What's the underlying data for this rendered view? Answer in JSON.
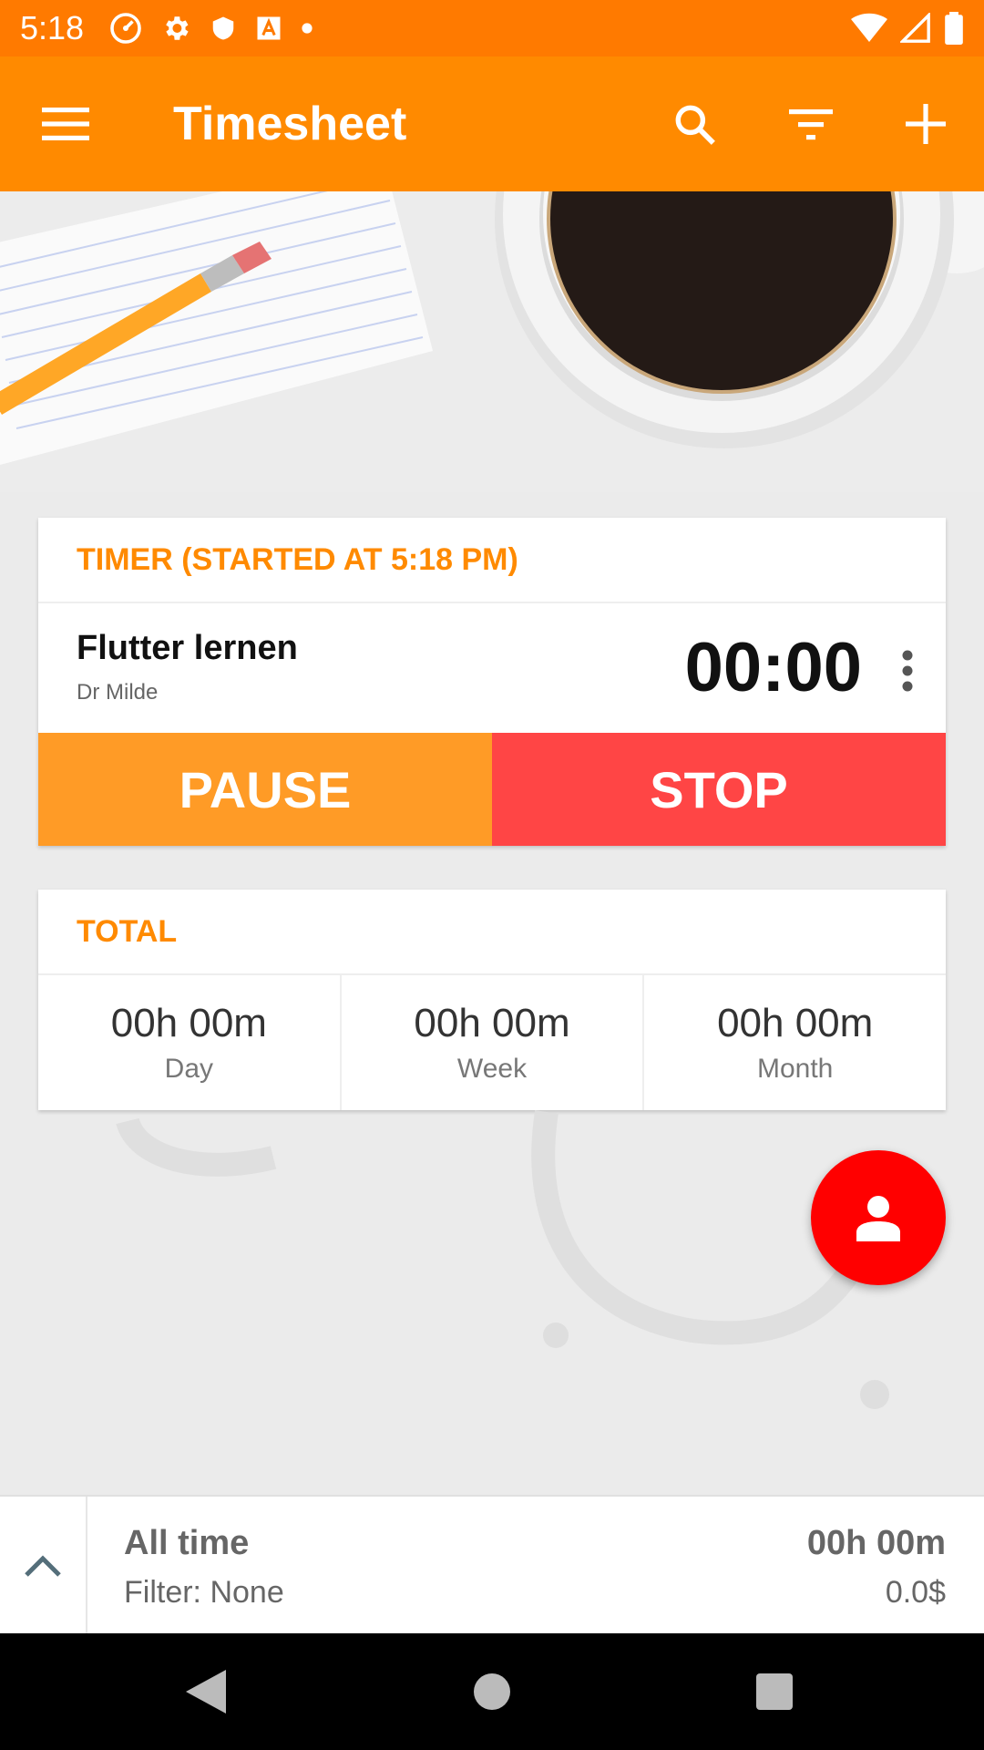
{
  "status_bar": {
    "time": "5:18",
    "left_icons": [
      "speedometer-icon",
      "gear-icon",
      "shield-icon",
      "font-icon",
      "dot-icon"
    ],
    "right_icons": [
      "wifi-icon",
      "cell-signal-icon",
      "battery-icon"
    ]
  },
  "app_bar": {
    "title": "Timesheet",
    "menu_icon": "menu-icon",
    "actions": [
      "search-icon",
      "filter-icon",
      "add-icon"
    ]
  },
  "timer_card": {
    "header": "TIMER (STARTED AT 5:18 PM)",
    "task_name": "Flutter lernen",
    "client": "Dr Milde",
    "elapsed": "00:00",
    "pause_label": "PAUSE",
    "stop_label": "STOP"
  },
  "totals_card": {
    "header": "TOTAL",
    "cells": [
      {
        "value": "00h 00m",
        "label": "Day"
      },
      {
        "value": "00h 00m",
        "label": "Week"
      },
      {
        "value": "00h 00m",
        "label": "Month"
      }
    ]
  },
  "fab": {
    "icon": "person-icon"
  },
  "summary": {
    "period": "All time",
    "filter": "Filter: None",
    "total": "00h 00m",
    "amount": "0.0$"
  },
  "colors": {
    "status_bar": "#ff7a00",
    "app_bar": "#ff8a00",
    "accent": "#ff8a00",
    "pause": "#ff9b26",
    "stop": "#ff4545",
    "fab": "#ff0000"
  }
}
